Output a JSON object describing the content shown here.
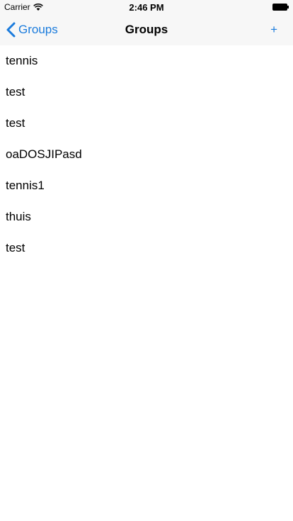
{
  "status_bar": {
    "carrier": "Carrier",
    "time": "2:46 PM"
  },
  "nav_bar": {
    "back_label": "Groups",
    "title": "Groups",
    "add_label": "+"
  },
  "groups": [
    {
      "name": "tennis"
    },
    {
      "name": "test"
    },
    {
      "name": "test"
    },
    {
      "name": "oaDOSJIPasd"
    },
    {
      "name": "tennis1"
    },
    {
      "name": "thuis"
    },
    {
      "name": "test"
    }
  ],
  "colors": {
    "accent": "#1a7bdc",
    "bar_background": "#f7f7f7"
  }
}
